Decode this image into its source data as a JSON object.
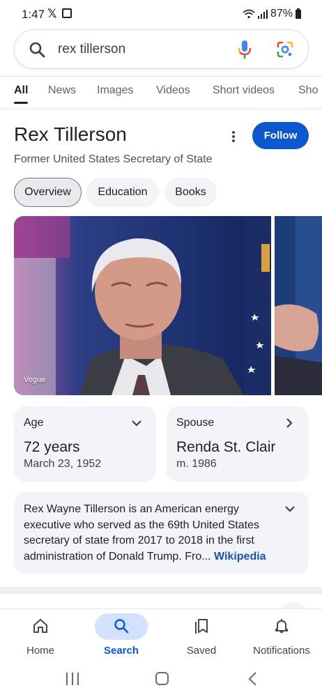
{
  "status_bar": {
    "time": "1:47",
    "x_icon": "𝕏",
    "battery": "87%"
  },
  "search": {
    "query": "rex tillerson",
    "icons": [
      "search-icon",
      "mic-icon",
      "lens-icon"
    ]
  },
  "tabs": [
    {
      "label": "All",
      "active": true
    },
    {
      "label": "News"
    },
    {
      "label": "Images"
    },
    {
      "label": "Videos"
    },
    {
      "label": "Short videos"
    },
    {
      "label": "Sho"
    }
  ],
  "knowledge_panel": {
    "title": "Rex Tillerson",
    "subtitle": "Former United States Secretary of State",
    "follow_label": "Follow",
    "chips": [
      {
        "label": "Overview",
        "active": true
      },
      {
        "label": "Education"
      },
      {
        "label": "Books"
      }
    ],
    "image_source": "Vogue",
    "facts": [
      {
        "label": "Age",
        "value": "72 years",
        "sub": "March 23, 1952",
        "icon": "chevron-down-icon"
      },
      {
        "label": "Spouse",
        "value": "Renda St. Clair",
        "sub": "m. 1986",
        "icon": "chevron-right-icon"
      }
    ],
    "description": {
      "text": "Rex Wayne Tillerson is an American energy executive who served as the 69th United States secretary of state from 2017 to 2018 in the first administration of Donald Trump. Fro",
      "ellipsis": "...",
      "link": "Wikipedia"
    }
  },
  "bottom_nav": [
    {
      "label": "Home",
      "icon": "home-icon"
    },
    {
      "label": "Search",
      "icon": "search-icon",
      "active": true
    },
    {
      "label": "Saved",
      "icon": "bookmarks-icon"
    },
    {
      "label": "Notifications",
      "icon": "bell-icon"
    }
  ],
  "colors": {
    "accent": "#0b57d0",
    "link": "#1a4fbe",
    "card_bg": "#f3f4f7",
    "active_pill": "#d3e3fd"
  }
}
